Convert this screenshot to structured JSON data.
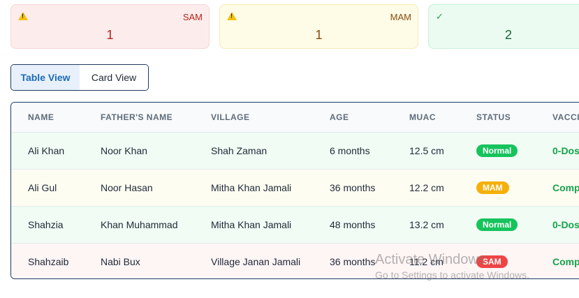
{
  "summary": {
    "sam": {
      "label": "SAM",
      "count": "1"
    },
    "mam": {
      "label": "MAM",
      "count": "1"
    },
    "normal": {
      "icon": "✓",
      "count": "2"
    }
  },
  "view_toggle": {
    "table_label": "Table View",
    "card_label": "Card View",
    "active": "table"
  },
  "table": {
    "headers": [
      "NAME",
      "FATHER'S NAME",
      "VILLAGE",
      "AGE",
      "MUAC",
      "STATUS",
      "VACCI"
    ],
    "rows": [
      {
        "name": "Ali Khan",
        "father": "Noor Khan",
        "village": "Shah Zaman",
        "age": "6 months",
        "muac": "12.5 cm",
        "status": "Normal",
        "vaccination": "0-Dos"
      },
      {
        "name": "Ali Gul",
        "father": "Noor Hasan",
        "village": "Mitha Khan Jamali",
        "age": "36 months",
        "muac": "12.2 cm",
        "status": "MAM",
        "vaccination": "Comp"
      },
      {
        "name": "Shahzia",
        "father": "Khan Muhammad",
        "village": "Mitha Khan Jamali",
        "age": "48 months",
        "muac": "13.2 cm",
        "status": "Normal",
        "vaccination": "0-Dos"
      },
      {
        "name": "Shahzaib",
        "father": "Nabi Bux",
        "village": "Village Janan Jamali",
        "age": "36 months",
        "muac": "11.2 cm",
        "status": "SAM",
        "vaccination": "Comp"
      }
    ]
  },
  "watermark": {
    "line1": "Activate Windows",
    "line2": "Go to Settings to activate Windows."
  },
  "colors": {
    "sam": "#ef4444",
    "mam": "#f5b00b",
    "normal": "#16c35c",
    "accent": "#1d6ab9"
  }
}
